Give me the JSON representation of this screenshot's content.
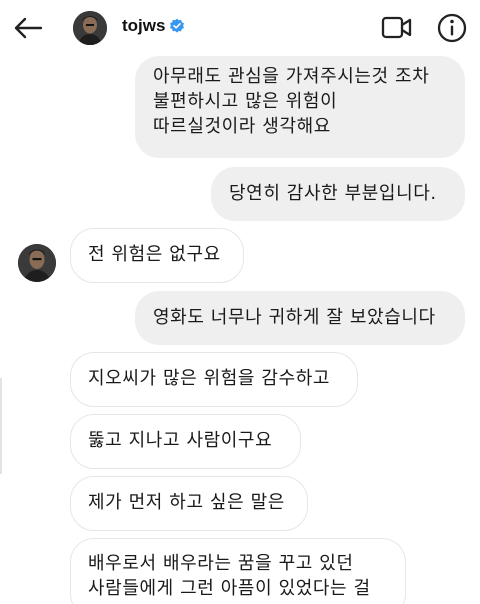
{
  "header": {
    "username": "tojws",
    "verified": true,
    "icons": [
      "back-arrow-icon",
      "avatar",
      "verified-badge-icon",
      "video-call-icon",
      "info-icon"
    ]
  },
  "messages": [
    {
      "side": "out",
      "lines": [
        "아무래도 관심을 가져주시는것 조차",
        "불편하시고 많은 위험이",
        "따르실것이라 생각해요"
      ]
    },
    {
      "side": "out",
      "lines": [
        "당연히 감사한 부분입니다."
      ]
    },
    {
      "side": "in",
      "lines": [
        "전 위험은 없구요"
      ]
    },
    {
      "side": "out",
      "lines": [
        "영화도 너무나 귀하게 잘 보았습니다"
      ]
    },
    {
      "side": "in",
      "lines": [
        "지오씨가 많은 위험을 감수하고"
      ]
    },
    {
      "side": "in",
      "lines": [
        "뚫고 지나고 사람이구요"
      ]
    },
    {
      "side": "in",
      "lines": [
        "제가 먼저 하고 싶은 말은"
      ]
    },
    {
      "side": "in",
      "lines": [
        "배우로서 배우라는 꿈을 꾸고 있던",
        "사람들에게 그런 아픔이 있었다는 걸"
      ]
    }
  ],
  "colors": {
    "outgoing_bubble": "#efefef",
    "incoming_border": "#e6e6e6",
    "verified_blue": "#3897f0",
    "text": "#111111"
  }
}
